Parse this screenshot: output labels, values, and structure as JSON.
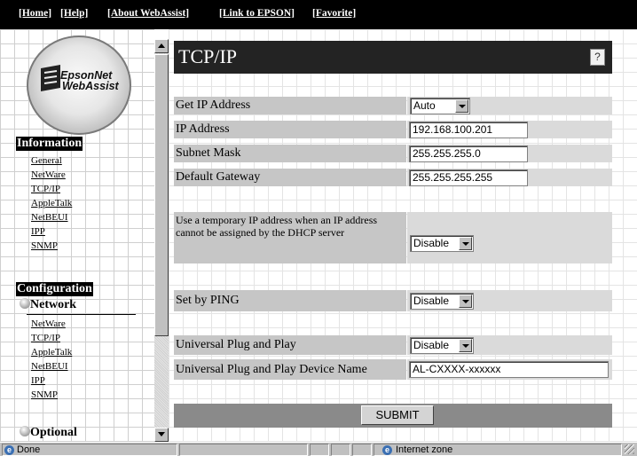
{
  "topnav": {
    "home": "[Home]",
    "help": "[Help]",
    "about": "[About WebAssist]",
    "link_epson": "[Link to EPSON]",
    "favorite": "[Favorite]"
  },
  "logo": {
    "line1": "EpsonNet",
    "line2": "WebAssist"
  },
  "sidebar": {
    "information_heading": "Information",
    "information_items": [
      "General",
      "NetWare",
      "TCP/IP",
      "AppleTalk",
      "NetBEUI",
      "IPP",
      "SNMP"
    ],
    "configuration_heading": "Configuration",
    "network_heading": "Network",
    "network_items": [
      "NetWare",
      "TCP/IP",
      "AppleTalk",
      "NetBEUI",
      "IPP",
      "SNMP"
    ],
    "optional_heading": "Optional"
  },
  "page": {
    "title": "TCP/IP",
    "help_icon": "?"
  },
  "form": {
    "get_ip_label": "Get IP Address",
    "get_ip_value": "Auto",
    "ip_label": "IP Address",
    "ip_value": "192.168.100.201",
    "subnet_label": "Subnet Mask",
    "subnet_value": "255.255.255.0",
    "gateway_label": "Default Gateway",
    "gateway_value": "255.255.255.255",
    "temp_ip_label": "Use a temporary IP address when an IP address cannot be assigned by the DHCP server",
    "temp_ip_value": "Disable",
    "ping_label": "Set by PING",
    "ping_value": "Disable",
    "upnp_label": "Universal Plug and Play",
    "upnp_value": "Disable",
    "upnp_name_label": "Universal Plug and Play Device Name",
    "upnp_name_value": "AL-CXXXX-xxxxxx",
    "submit_label": "SUBMIT"
  },
  "statusbar": {
    "status_text": "Done",
    "zone_text": "Internet zone"
  },
  "icons": {
    "help": "question-mark-icon",
    "bullet": "radio-bullet-icon",
    "browser": "ie-globe-icon"
  },
  "colors": {
    "topnav_bg": "#000000",
    "title_bg": "#232323",
    "label_bg": "#c6c6c6",
    "control_bg": "#dadada",
    "submit_bar_bg": "#8a8a8a"
  }
}
